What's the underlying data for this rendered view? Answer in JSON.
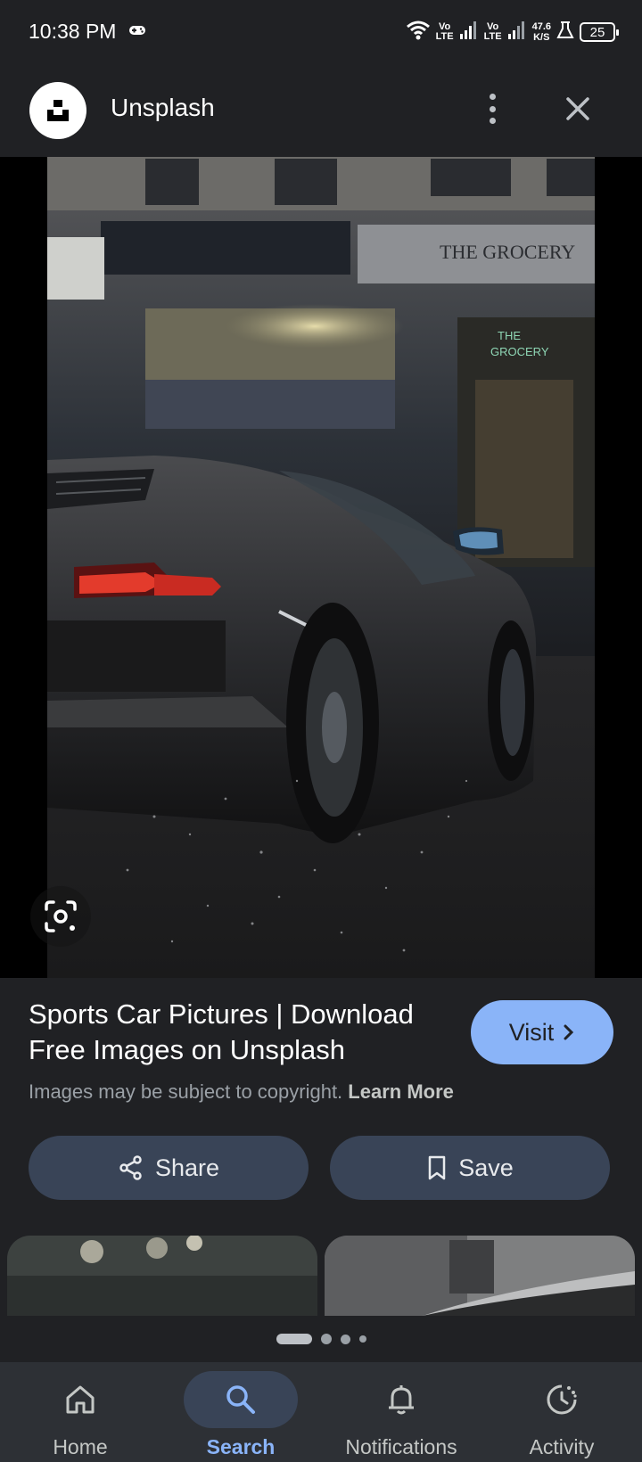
{
  "status_bar": {
    "time": "10:38 PM",
    "sim1": [
      "Vo",
      "LTE"
    ],
    "sim2": [
      "Vo",
      "LTE"
    ],
    "speed_value": "47.6",
    "speed_unit": "K/S",
    "battery": "25"
  },
  "header": {
    "site_name": "Unsplash"
  },
  "result": {
    "title": "Sports Car Pictures | Download Free Images on Unsplash",
    "visit_label": "Visit",
    "copyright_text": "Images may be subject to copyright.",
    "learn_more": "Learn More",
    "share_label": "Share",
    "save_label": "Save"
  },
  "bottom_nav": {
    "items": [
      {
        "label": "Home",
        "icon": "home-icon"
      },
      {
        "label": "Search",
        "icon": "search-icon",
        "active": true
      },
      {
        "label": "Notifications",
        "icon": "bell-icon"
      },
      {
        "label": "Activity",
        "icon": "activity-icon"
      }
    ]
  },
  "colors": {
    "background": "#202124",
    "accent": "#8ab4f8",
    "button_bg": "#394457",
    "nav_bg": "#2d3035"
  }
}
